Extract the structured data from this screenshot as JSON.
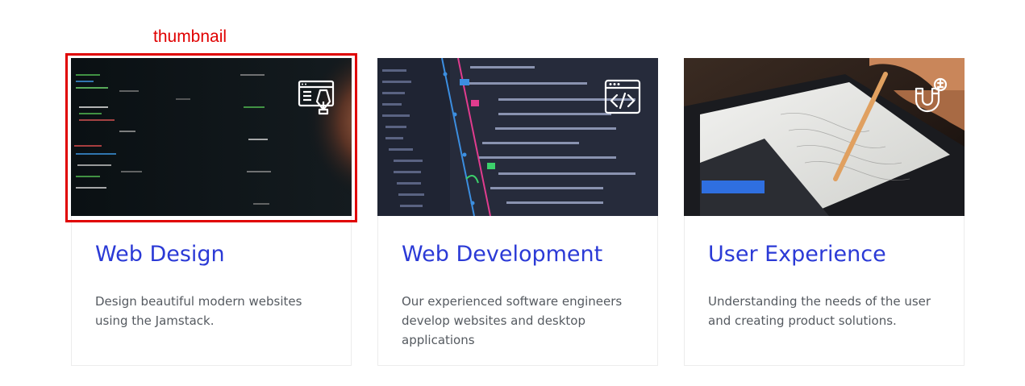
{
  "annotation": {
    "label": "thumbnail",
    "color": "#e00000"
  },
  "cards": [
    {
      "title": "Web Design",
      "description": "Design beautiful modern websites using the Jamstack.",
      "icon": "web-design-icon"
    },
    {
      "title": "Web Development",
      "description": "Our experienced software engineers develop websites and desktop applications",
      "icon": "code-window-icon"
    },
    {
      "title": "User Experience",
      "description": "Understanding the needs of the user and creating product solutions.",
      "icon": "magnet-icon"
    }
  ],
  "colors": {
    "title": "#2b3ad6",
    "text": "#555a60",
    "card_border": "#ececec"
  }
}
